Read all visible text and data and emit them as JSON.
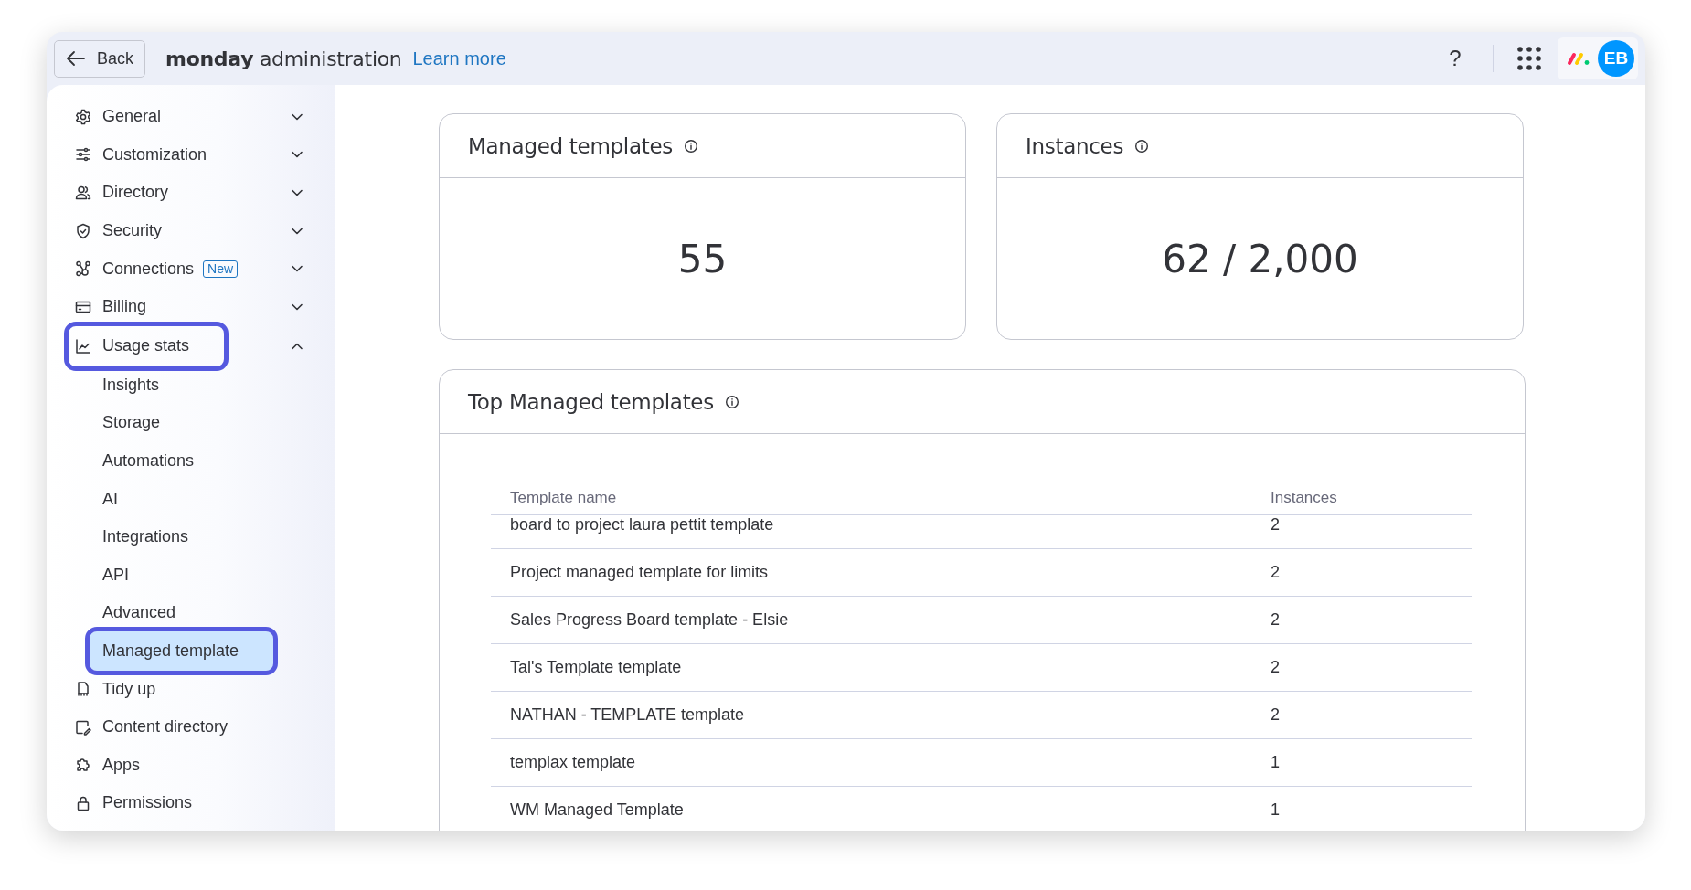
{
  "top_bar": {
    "back_button": "Back",
    "title": "**monday** administration",
    "link": "Learn more",
    "help": "?",
    "avatar": "EB"
  },
  "sidebar": {
    "items": [
      {
        "label": "General",
        "kind": "group",
        "expanded": false,
        "highlighted": false
      },
      {
        "label": "Customization",
        "kind": "group",
        "expanded": false,
        "highlighted": false
      },
      {
        "label": "Directory",
        "kind": "group",
        "expanded": false,
        "highlighted": false
      },
      {
        "label": "Security",
        "kind": "group",
        "expanded": false,
        "highlighted": false
      },
      {
        "label": "Connections",
        "kind": "group",
        "expanded": false,
        "highlighted": false,
        "badge": "New"
      },
      {
        "label": "Billing",
        "kind": "group",
        "expanded": false,
        "highlighted": false
      },
      {
        "label": "Usage stats",
        "kind": "group",
        "expanded": true,
        "highlighted": true,
        "children": [
          {
            "label": "Insights",
            "selected": false,
            "highlighted": false
          },
          {
            "label": "Storage",
            "selected": false,
            "highlighted": false
          },
          {
            "label": "Automations",
            "selected": false,
            "highlighted": false
          },
          {
            "label": "AI",
            "selected": false,
            "highlighted": false
          },
          {
            "label": "Integrations",
            "selected": false,
            "highlighted": false
          },
          {
            "label": "API",
            "selected": false,
            "highlighted": false
          },
          {
            "label": "Advanced",
            "selected": false,
            "highlighted": false
          },
          {
            "label": "Managed template",
            "selected": true,
            "highlighted": true
          }
        ]
      },
      {
        "label": "Tidy up",
        "kind": "link",
        "highlighted": false
      },
      {
        "label": "Content directory",
        "kind": "link",
        "highlighted": false
      },
      {
        "label": "Apps",
        "kind": "link",
        "highlighted": false
      },
      {
        "label": "Permissions",
        "kind": "link",
        "highlighted": false
      }
    ]
  },
  "stat_cards": [
    {
      "title": "Managed templates",
      "value": "55"
    },
    {
      "title": "Instances",
      "value": "62 / 2,000"
    }
  ],
  "table": {
    "title": "Top Managed templates",
    "columns": [
      "Template name",
      "Instances"
    ],
    "rows": [
      [
        "board to project laura pettit template",
        "2"
      ],
      [
        "Project managed template for limits",
        "2"
      ],
      [
        "Sales Progress Board template - Elsie",
        "2"
      ],
      [
        "Tal's Template template",
        "2"
      ],
      [
        "NATHAN - TEMPLATE template",
        "2"
      ],
      [
        "templax template",
        "1"
      ],
      [
        "WM Managed Template",
        "1"
      ]
    ]
  }
}
